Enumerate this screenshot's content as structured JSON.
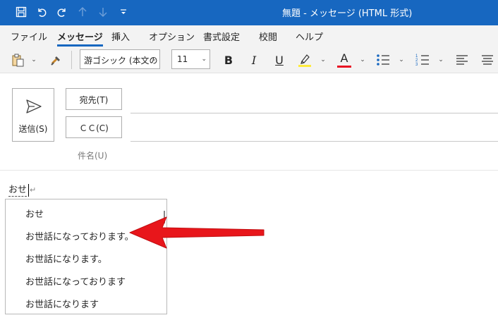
{
  "window": {
    "title": "無題 - メッセージ (HTML 形式)"
  },
  "menu": {
    "tabs": [
      "ファイル",
      "メッセージ",
      "挿入",
      "オプション",
      "書式設定",
      "校閲",
      "ヘルプ"
    ],
    "active_tab": "メッセージ"
  },
  "ribbon": {
    "font_name": "游ゴシック (本文の",
    "font_size": "11",
    "bold": "B",
    "italic": "I",
    "underline": "U",
    "font_color_letter": "A",
    "highlight_color": "#ffeb3b",
    "font_color": "#e81123"
  },
  "header": {
    "send_label": "送信(S)",
    "to_label": "宛先(T)",
    "cc_label": "ＣＣ(C)",
    "subject_label": "件名(U)"
  },
  "body": {
    "typed_text": "おせ",
    "paragraph_mark": "↵"
  },
  "ime": {
    "candidates": [
      "おせ",
      "お世話になっております。",
      "お世話になります。",
      "お世話になっております",
      "お世話になります"
    ]
  },
  "colors": {
    "title_bar": "#1767c0",
    "ribbon_bg": "#f3f3f3",
    "annotation_arrow": "#e8161b"
  }
}
